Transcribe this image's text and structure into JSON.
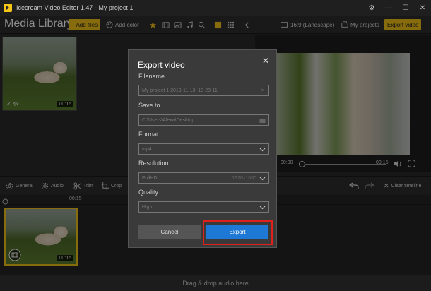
{
  "window": {
    "title": "Icecream Video Editor 1.47  -  My project 1",
    "controls": [
      "⚙",
      "—",
      "☐",
      "✕"
    ]
  },
  "toolbar": {
    "media_library": "Media Library",
    "add_files": "+ Add files",
    "add_color": "Add color",
    "aspect": "16:9 (Landscape)",
    "my_projects": "My projects",
    "export_video": "Export video"
  },
  "media": {
    "thumb_duration": "00:15",
    "thumb_status": "✓ 4×"
  },
  "preview": {
    "time_start": "00:00",
    "time_end": "00:15"
  },
  "editbar": {
    "general": "General",
    "audio": "Audio",
    "trim": "Trim",
    "crop": "Crop",
    "clear_timeline": "Clear timeline"
  },
  "timeline": {
    "ruler_mark": "00:15",
    "clip_duration": "00:15",
    "drop_hint": "Drag & drop audio here"
  },
  "dialog": {
    "title": "Export video",
    "close": "✕",
    "filename_label": "Filename",
    "filename_value": "My project 1 2019-11-13_18-29-11",
    "save_to_label": "Save to",
    "save_to_value": "C:\\Users\\Alexa\\Desktop",
    "format_label": "Format",
    "format_value": "mp4",
    "resolution_label": "Resolution",
    "resolution_value": "FullHD",
    "resolution_detail": "1920x1080",
    "quality_label": "Quality",
    "quality_value": "High",
    "cancel": "Cancel",
    "export": "Export"
  },
  "colors": {
    "accent_yellow": "#f5c518",
    "export_blue": "#1e78d6",
    "highlight_red": "#e0201a"
  }
}
